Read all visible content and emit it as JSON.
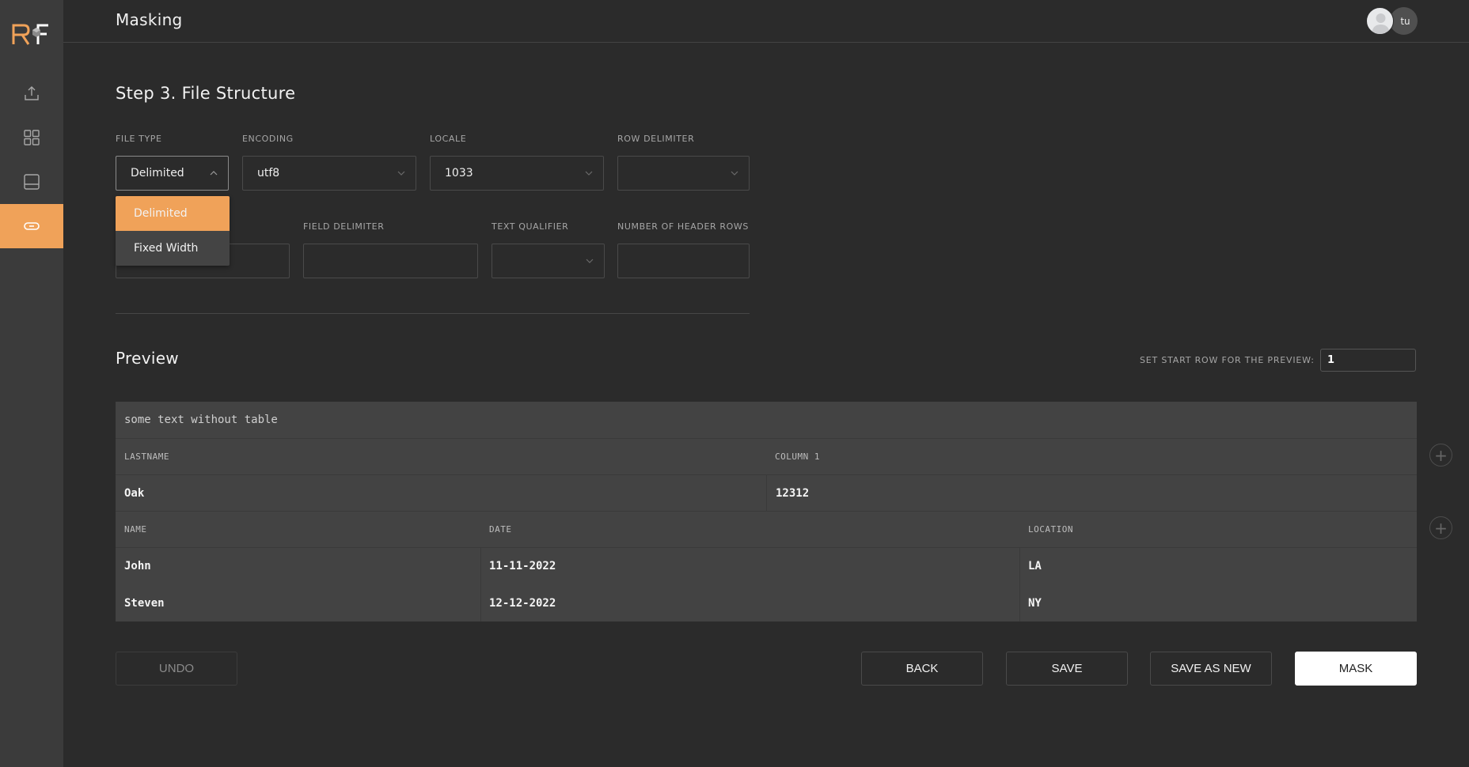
{
  "header": {
    "title": "Masking",
    "user_initials": "tu"
  },
  "sidebar": {
    "logo": "RF",
    "items": [
      {
        "icon": "upload-icon",
        "active": false
      },
      {
        "icon": "grid-icon",
        "active": false
      },
      {
        "icon": "panel-icon",
        "active": false
      },
      {
        "icon": "link-icon",
        "active": true
      }
    ],
    "accent_color": "#f0a259"
  },
  "step": {
    "title": "Step 3. File Structure"
  },
  "form": {
    "file_type": {
      "label": "FILE TYPE",
      "value": "Delimited",
      "open": true
    },
    "encoding": {
      "label": "ENCODING",
      "value": "utf8"
    },
    "locale": {
      "label": "LOCALE",
      "value": "1033"
    },
    "row_delimiter": {
      "label": "ROW DELIMITER",
      "value": ""
    },
    "hidden_field": {
      "value": ""
    },
    "field_delimiter": {
      "label": "FIELD DELIMITER",
      "value": ""
    },
    "text_qualifier": {
      "label": "TEXT QUALIFIER",
      "value": ""
    },
    "header_rows": {
      "label": "NUMBER OF HEADER ROWS",
      "value": ""
    }
  },
  "file_type_dropdown": {
    "options": [
      "Delimited",
      "Fixed Width"
    ],
    "selected": "Delimited"
  },
  "preview": {
    "title": "Preview",
    "start_row_label": "SET START ROW FOR THE PREVIEW:",
    "start_row_value": "1",
    "raw_text": "some text without table",
    "table1": {
      "headers": [
        "LASTNAME",
        "COLUMN 1"
      ],
      "rows": [
        [
          "Oak",
          "12312"
        ]
      ]
    },
    "table2": {
      "headers": [
        "NAME",
        "DATE",
        "LOCATION"
      ],
      "rows": [
        [
          "John",
          "11-11-2022",
          "LA"
        ],
        [
          "Steven",
          "12-12-2022",
          "NY"
        ]
      ]
    }
  },
  "actions": {
    "undo": "UNDO",
    "back": "BACK",
    "save": "SAVE",
    "save_as_new": "SAVE AS NEW",
    "mask": "MASK"
  }
}
